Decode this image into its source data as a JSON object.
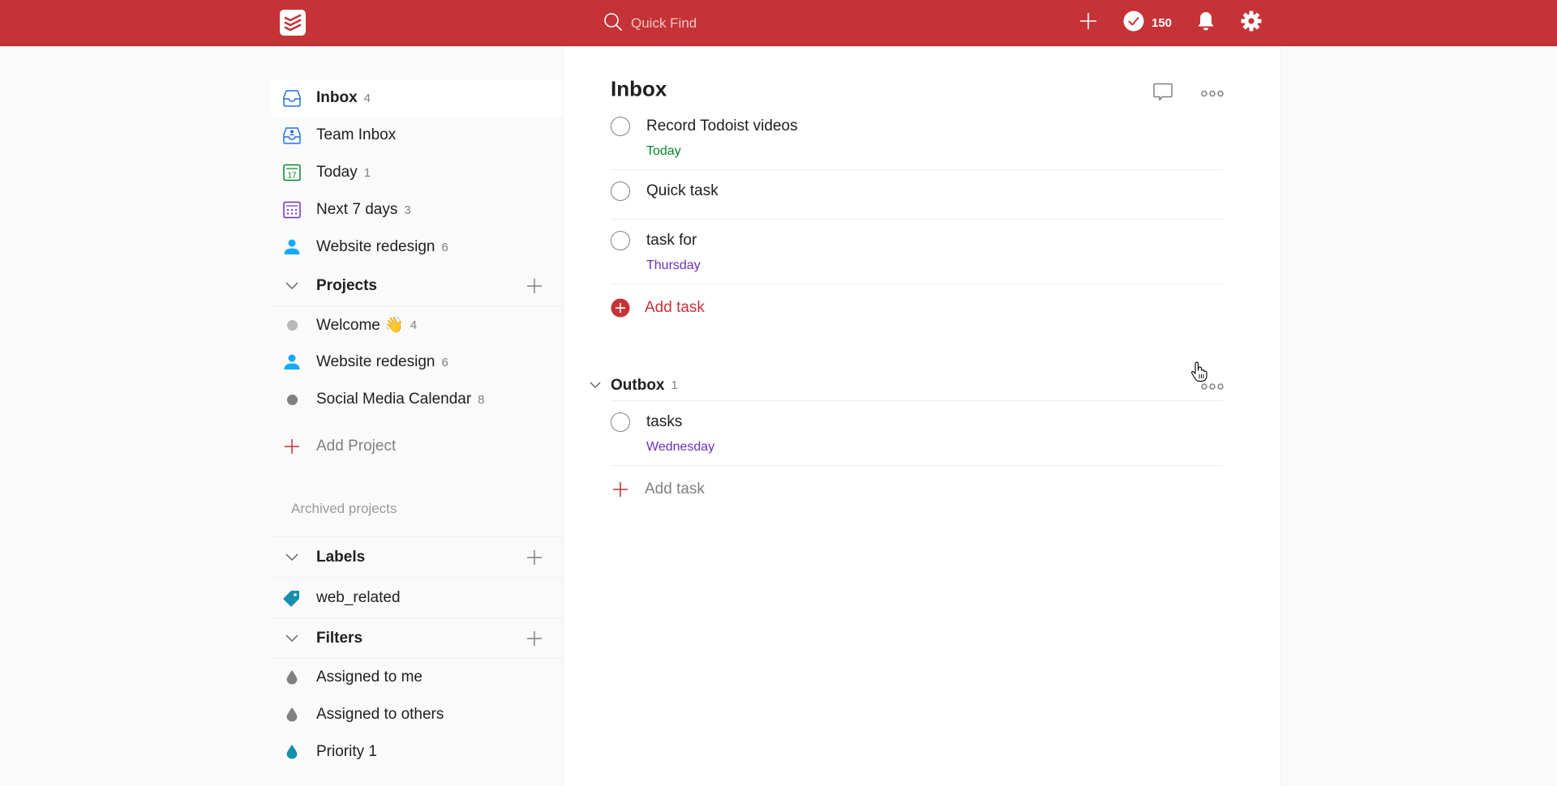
{
  "topbar": {
    "logo": "todoist-logo-icon",
    "search_placeholder": "Quick Find",
    "karma_count": "150",
    "icons": [
      "search-icon",
      "plus-icon",
      "karma-check-icon",
      "bell-icon",
      "gear-icon"
    ]
  },
  "sidebar": {
    "filters_top": [
      {
        "label": "Inbox",
        "count": "4",
        "icon": "inbox-icon",
        "active": true,
        "color": "#246fe0"
      },
      {
        "label": "Team Inbox",
        "count": "",
        "icon": "team-inbox-icon",
        "color": "#246fe0"
      },
      {
        "label": "Today",
        "count": "1",
        "icon": "calendar-today-icon",
        "day": "17",
        "color": "#058527"
      },
      {
        "label": "Next 7 days",
        "count": "3",
        "icon": "calendar-week-icon",
        "color": "#692fc2"
      },
      {
        "label": "Website redesign",
        "count": "6",
        "icon": "person-icon",
        "color": "#14aaf5"
      }
    ],
    "projects": {
      "title": "Projects",
      "items": [
        {
          "label": "Welcome 👋",
          "count": "4",
          "icon": "dot",
          "color": "#b8b8b8"
        },
        {
          "label": "Website redesign",
          "count": "6",
          "icon": "person-icon",
          "color": "#14aaf5"
        },
        {
          "label": "Social Media Calendar",
          "count": "8",
          "icon": "dot",
          "color": "#808080"
        }
      ],
      "add_label": "Add Project",
      "archived_label": "Archived projects"
    },
    "labels": {
      "title": "Labels",
      "items": [
        {
          "label": "web_related",
          "icon": "tag-icon",
          "color": "#158fad"
        }
      ]
    },
    "filters": {
      "title": "Filters",
      "items": [
        {
          "label": "Assigned to me",
          "icon": "drop-icon",
          "color": "#808080"
        },
        {
          "label": "Assigned to others",
          "icon": "drop-icon",
          "color": "#808080"
        },
        {
          "label": "Priority 1",
          "icon": "drop-icon",
          "color": "#158fad"
        }
      ]
    }
  },
  "main": {
    "title": "Inbox",
    "tasks": [
      {
        "content": "Record Todoist videos",
        "due": "Today",
        "due_color": "#058527"
      },
      {
        "content": "Quick task",
        "due": "",
        "due_color": ""
      },
      {
        "content": "task for",
        "due": "Thursday",
        "due_color": "#692fc2"
      }
    ],
    "add_task_label": "Add task",
    "sections": [
      {
        "title": "Outbox",
        "count": "1",
        "tasks": [
          {
            "content": "tasks",
            "due": "Wednesday",
            "due_color": "#692fc2"
          }
        ],
        "add_task_label": "Add task"
      }
    ]
  },
  "colors": {
    "brand": "#c53337",
    "today_green": "#058527",
    "weekday_purple": "#692fc2"
  }
}
